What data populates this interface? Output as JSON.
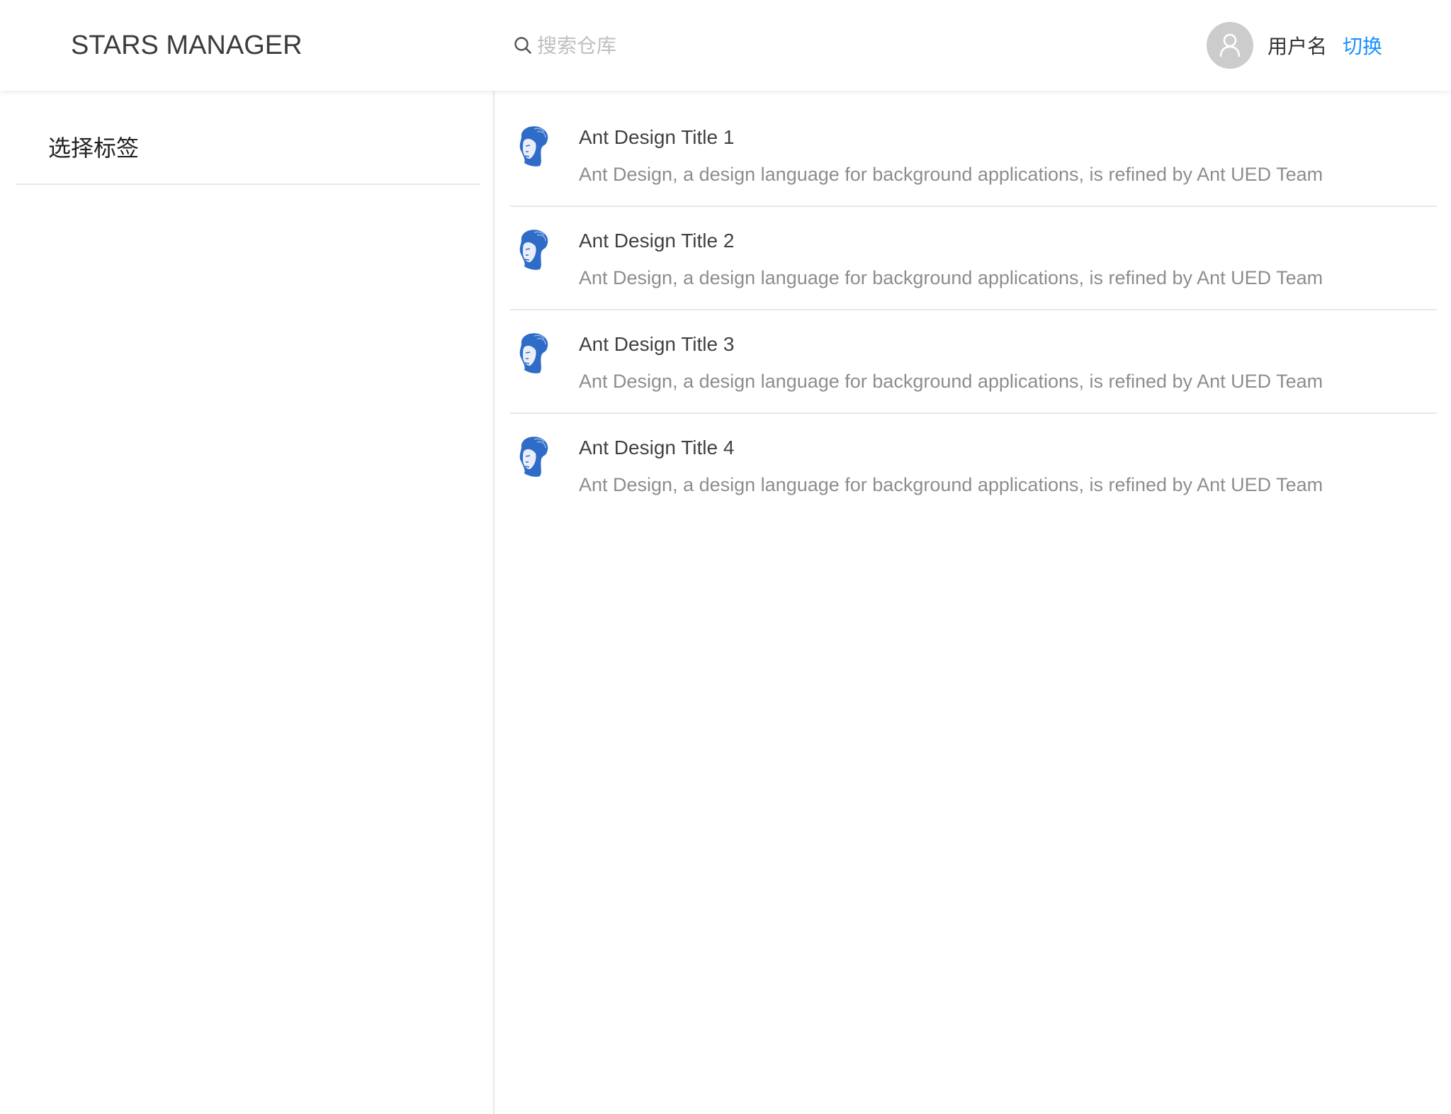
{
  "header": {
    "logo": "STARS MANAGER",
    "search_placeholder": "搜索仓库",
    "username": "用户名",
    "switch_label": "切换"
  },
  "sidebar": {
    "title": "选择标签"
  },
  "list": {
    "items": [
      {
        "title": "Ant Design Title 1",
        "description": "Ant Design, a design language for background applications, is refined by Ant UED Team"
      },
      {
        "title": "Ant Design Title 2",
        "description": "Ant Design, a design language for background applications, is refined by Ant UED Team"
      },
      {
        "title": "Ant Design Title 3",
        "description": "Ant Design, a design language for background applications, is refined by Ant UED Team"
      },
      {
        "title": "Ant Design Title 4",
        "description": "Ant Design, a design language for background applications, is refined by Ant UED Team"
      }
    ]
  },
  "colors": {
    "accent": "#1890ff",
    "avatar_bg": "#cccccc",
    "divider": "#e8e8e8"
  }
}
